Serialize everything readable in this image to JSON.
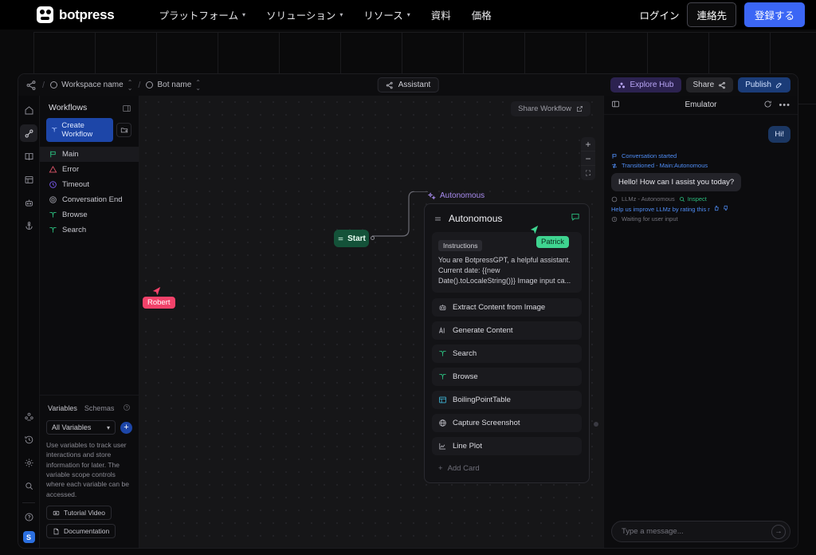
{
  "site_nav": {
    "brand": "botpress",
    "links": [
      {
        "label": "プラットフォーム",
        "has_caret": true
      },
      {
        "label": "ソリューション",
        "has_caret": true
      },
      {
        "label": "リソース",
        "has_caret": true
      },
      {
        "label": "資料",
        "has_caret": false
      },
      {
        "label": "価格",
        "has_caret": false
      }
    ],
    "login": "ログイン",
    "contact": "連絡先",
    "signup": "登録する",
    "primary_color": "#3b66f5"
  },
  "app": {
    "topbar": {
      "breadcrumb": [
        {
          "label": "Workspace name"
        },
        {
          "label": "Bot name"
        }
      ],
      "assistant_pill": "Assistant",
      "explore_hub": "Explore Hub",
      "share": "Share",
      "publish": "Publish"
    },
    "rail": {
      "items": [
        {
          "name": "home-icon"
        },
        {
          "name": "workflows-icon",
          "active": true
        },
        {
          "name": "knowledge-book-icon"
        },
        {
          "name": "tables-icon"
        },
        {
          "name": "bot-icon"
        },
        {
          "name": "integrations-anchor-icon"
        }
      ],
      "bottom_items": [
        {
          "name": "team-icon"
        },
        {
          "name": "history-icon"
        },
        {
          "name": "settings-gear-icon"
        },
        {
          "name": "search-icon"
        },
        {
          "name": "help-icon"
        }
      ],
      "avatar_initial": "S"
    },
    "workflows": {
      "title": "Workflows",
      "create_button": "Create Workflow",
      "items": [
        {
          "label": "Main",
          "icon": "flag-icon",
          "color": "#2bbd7e",
          "active": true
        },
        {
          "label": "Error",
          "icon": "warning-triangle-icon",
          "color": "#e0566a",
          "active": false
        },
        {
          "label": "Timeout",
          "icon": "clock-icon",
          "color": "#7c5cf0",
          "active": false
        },
        {
          "label": "Conversation End",
          "icon": "stop-icon",
          "color": "#9a9aa3",
          "active": false
        },
        {
          "label": "Browse",
          "icon": "workflow-icon",
          "color": "#2bbd7e",
          "active": false
        },
        {
          "label": "Search",
          "icon": "workflow-icon",
          "color": "#2bbd7e",
          "active": false
        }
      ],
      "variables": {
        "tab_variables": "Variables",
        "tab_schemas": "Schemas",
        "filter_value": "All Variables",
        "description": "Use variables to track user interactions and store information for later. The variable scope controls where each variable can be accessed.",
        "tutorial_button": "Tutorial Video",
        "documentation_button": "Documentation"
      }
    },
    "canvas": {
      "share_workflow": "Share Workflow",
      "zoom_in": "+",
      "zoom_out": "−",
      "fit_view": "⛶",
      "start_node": {
        "label": "Start"
      },
      "autonomous_node": {
        "tag": "Autonomous",
        "title": "Autonomous",
        "instructions_chip": "Instructions",
        "instructions_text": "You are BotpressGPT, a helpful assistant. Current date: {{new Date().toLocaleString()}} Image input ca...",
        "cards": [
          {
            "label": "Extract Content from Image",
            "icon": "robot-icon"
          },
          {
            "label": "Generate Content",
            "icon": "text-generate-icon"
          },
          {
            "label": "Search",
            "icon": "workflow-icon"
          },
          {
            "label": "Browse",
            "icon": "workflow-icon"
          },
          {
            "label": "BoilingPointTable",
            "icon": "table-icon"
          },
          {
            "label": "Capture Screenshot",
            "icon": "globe-icon"
          },
          {
            "label": "Line Plot",
            "icon": "line-chart-icon"
          }
        ],
        "add_card": "Add Card"
      },
      "cursors": [
        {
          "name": "Robert",
          "color": "#f2426a"
        },
        {
          "name": "Patrick",
          "color": "#3fd490"
        }
      ]
    },
    "emulator": {
      "title": "Emulator",
      "messages": [
        {
          "type": "user",
          "text": "Hi!"
        },
        {
          "type": "event",
          "text": "Conversation started",
          "icon": "flag-icon"
        },
        {
          "type": "event",
          "text": "Transitioned - Main:Autonomous",
          "icon": "transition-icon"
        },
        {
          "type": "bot",
          "text": "Hello! How can I assist you today?"
        }
      ],
      "meta_label": "LLMz - Autonomous",
      "inspect_label": "Inspect",
      "rating_prompt": "Help us improve LLMz by rating this r",
      "waiting_label": "Waiting for user input",
      "input_placeholder": "Type a message..."
    }
  }
}
